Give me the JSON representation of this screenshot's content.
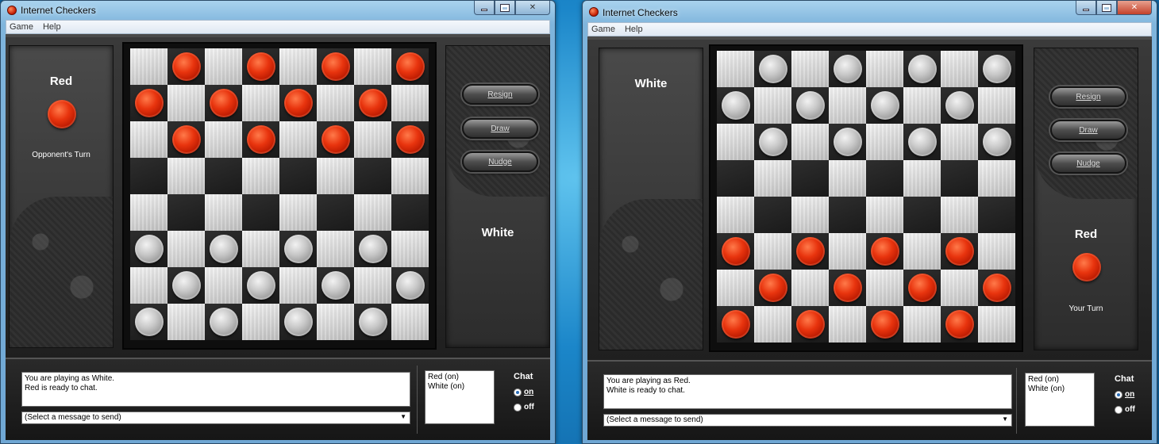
{
  "windows": [
    {
      "title": "Internet Checkers",
      "menu": [
        "Game",
        "Help"
      ],
      "board_top": "red",
      "board": [
        "_r_r_r_r",
        "r_r_r_r_",
        "_r_r_r_r",
        "________",
        "________",
        "w_w_w_w_",
        "_w_w_w_w",
        "w_w_w_w_"
      ],
      "opponent": {
        "label": "Red",
        "piece": "red",
        "status": "Opponent's Turn"
      },
      "self": {
        "label": "White",
        "piece": "white",
        "status": ""
      },
      "buttons": {
        "resign": "Resign",
        "draw": "Draw",
        "nudge": "Nudge"
      },
      "log": [
        "You are playing as White.",
        "Red is ready to chat."
      ],
      "message_select": "(Select a message to send)",
      "users": [
        "Red (on)",
        "White (on)"
      ],
      "chat": {
        "title": "Chat",
        "on": "on",
        "off": "off",
        "selected": "on"
      }
    },
    {
      "title": "Internet Checkers",
      "menu": [
        "Game",
        "Help"
      ],
      "board_top": "white",
      "board": [
        "_w_w_w_w",
        "w_w_w_w_",
        "_w_w_w_w",
        "________",
        "________",
        "r_r_r_r_",
        "_r_r_r_r",
        "r_r_r_r_"
      ],
      "opponent": {
        "label": "White",
        "piece": "white",
        "status": ""
      },
      "self": {
        "label": "Red",
        "piece": "red",
        "status": "Your Turn"
      },
      "buttons": {
        "resign": "Resign",
        "draw": "Draw",
        "nudge": "Nudge"
      },
      "log": [
        "You are playing as Red.",
        "White is ready to chat."
      ],
      "message_select": "(Select a message to send)",
      "users": [
        "Red (on)",
        "White (on)"
      ],
      "chat": {
        "title": "Chat",
        "on": "on",
        "off": "off",
        "selected": "on"
      }
    }
  ]
}
